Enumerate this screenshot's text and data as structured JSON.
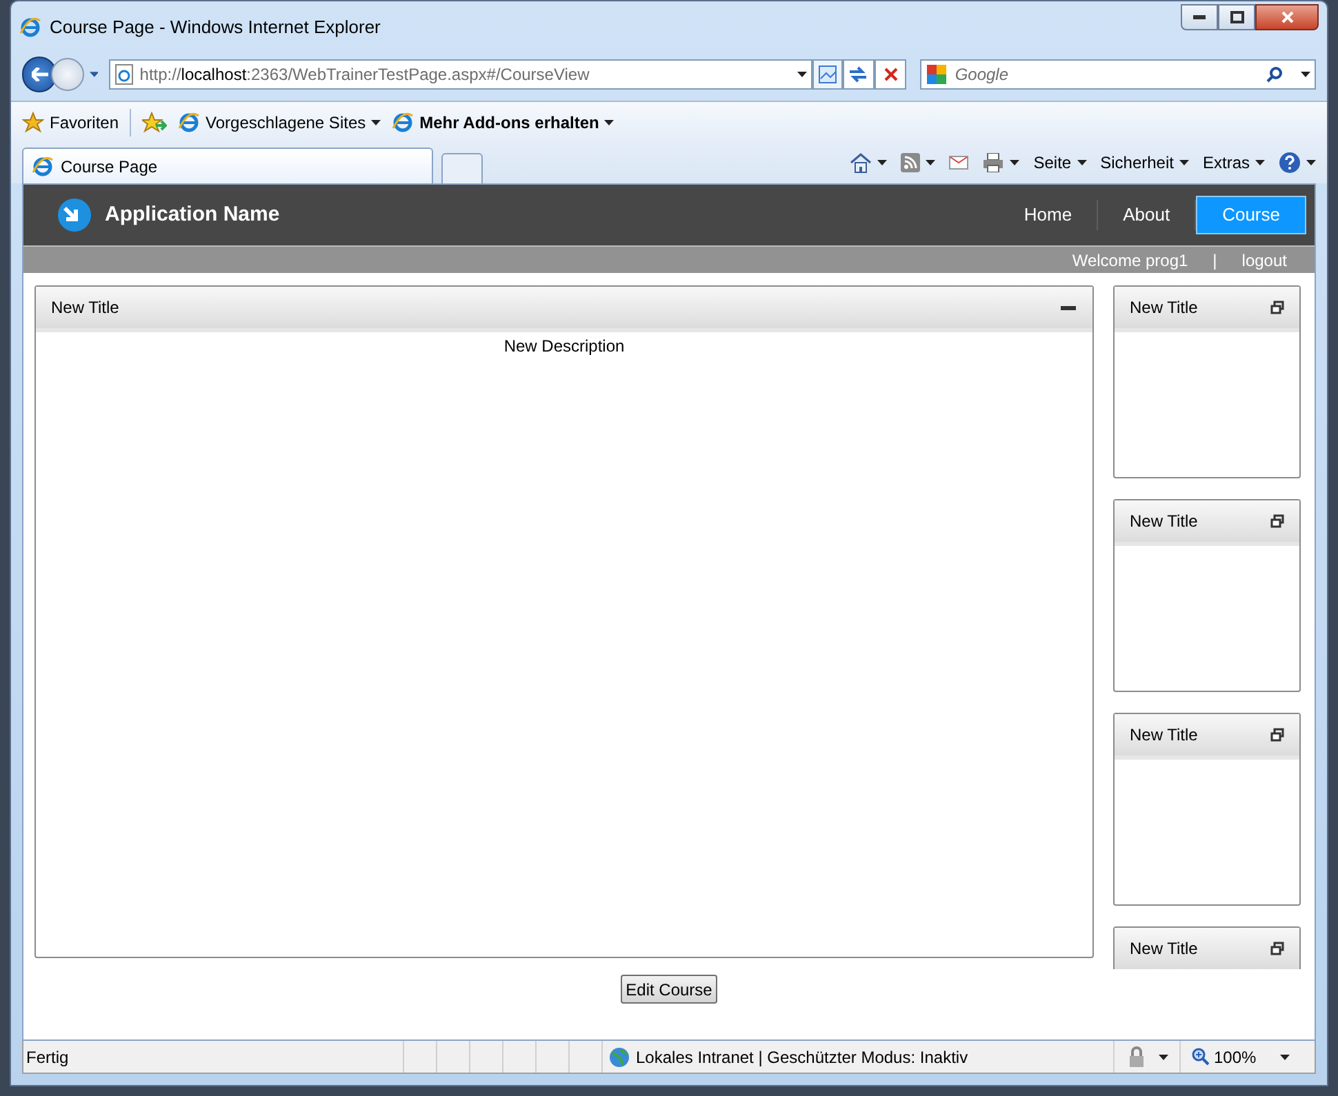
{
  "window": {
    "title": "Course Page - Windows Internet Explorer"
  },
  "address_bar": {
    "url": "http://**localhost**:2363/WebTrainerTestPage.aspx#/CourseView"
  },
  "search": {
    "placeholder": "Google"
  },
  "favorites_bar": [
    {
      "label": "Favoriten",
      "kind": "favorites"
    },
    {
      "label": "Vorgeschlagene Sites",
      "kind": "dropdown"
    },
    {
      "label": "Mehr Add-ons erhalten",
      "kind": "dropdown"
    }
  ],
  "tabs": [
    {
      "label": "Course Page",
      "selected": true
    }
  ],
  "command_bar": [
    "Seite",
    "Sicherheit",
    "Extras"
  ],
  "app": {
    "name": "Application Name",
    "nav": [
      {
        "label": "Home",
        "selected": false
      },
      {
        "label": "About",
        "selected": false
      },
      {
        "label": "Course",
        "selected": true
      }
    ],
    "welcome": "Welcome prog1",
    "separator": "|",
    "logout": "logout"
  },
  "main_panel": {
    "title": "New Title",
    "description": "New Description"
  },
  "side_panels": [
    {
      "title": "New Title"
    },
    {
      "title": "New Title"
    },
    {
      "title": "New Title"
    },
    {
      "title": "New Title"
    }
  ],
  "edit_button": "Edit Course",
  "status_bar": {
    "status": "Fertig",
    "zone": "Lokales Intranet | Geschützter Modus: Inaktiv",
    "zoom": "100%"
  }
}
